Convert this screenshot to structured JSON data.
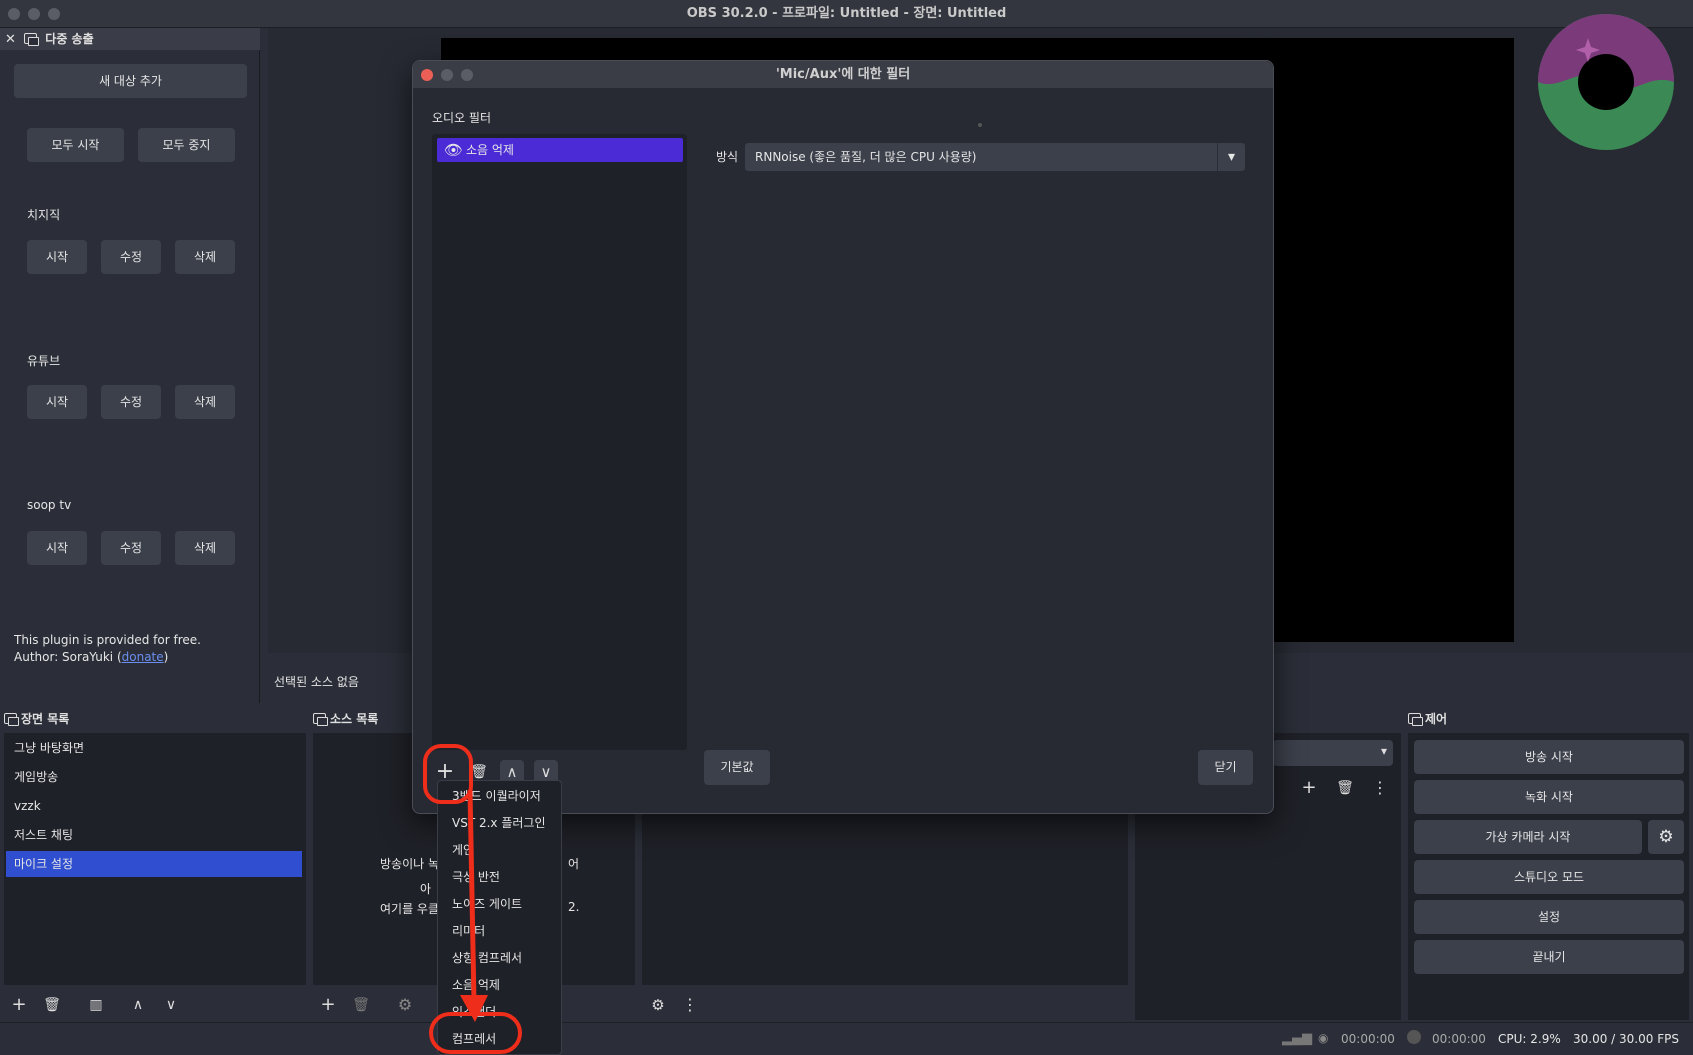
{
  "window": {
    "title": "OBS 30.2.0 - 프로파일: Untitled - 장면: Untitled"
  },
  "multistream": {
    "title": "다중 송출",
    "add_target": "새 대상 추가",
    "start_all": "모두 시작",
    "stop_all": "모두 중지",
    "targets": [
      {
        "name": "치지직",
        "start": "시작",
        "edit": "수정",
        "delete": "삭제"
      },
      {
        "name": "유튜브",
        "start": "시작",
        "edit": "수정",
        "delete": "삭제"
      },
      {
        "name": "soop tv",
        "start": "시작",
        "edit": "수정",
        "delete": "삭제"
      }
    ],
    "footer_line1": "This plugin is provided for free.",
    "footer_prefix": "Author: SoraYuki (",
    "footer_link": "donate",
    "footer_suffix": ")"
  },
  "preview": {
    "no_source": "선택된 소스 없음"
  },
  "scenes": {
    "title": "장면 목록",
    "items": [
      "그냥 바탕화면",
      "게임방송",
      "vzzk",
      "저스트 채팅",
      "마이크 설정"
    ],
    "selected_index": 4
  },
  "sources": {
    "title": "소스 목록",
    "hint_line1": "방송이나 녹",
    "hint_line1_end": "어",
    "hint_line2": "아",
    "hint_line3": "여기를 우클",
    "hint_line3_end": "2."
  },
  "controls": {
    "title": "제어",
    "start_stream": "방송 시작",
    "start_record": "녹화 시작",
    "virtual_cam": "가상 카메라 시작",
    "studio_mode": "스튜디오 모드",
    "settings": "설정",
    "exit": "끝내기"
  },
  "statusbar": {
    "stream_time": "00:00:00",
    "record_time": "00:00:00",
    "cpu": "CPU: 2.9%",
    "fps": "30.00 / 30.00 FPS"
  },
  "filter_dialog": {
    "title": "'Mic/Aux'에 대한 필터",
    "section_label": "오디오 필터",
    "filters": [
      {
        "name": "소음 억제",
        "visible": true
      }
    ],
    "method_label": "방식",
    "method_value": "RNNoise (좋은 품질, 더 많은 CPU 사용량)",
    "defaults_button": "기본값",
    "close_button": "닫기"
  },
  "add_menu": {
    "items": [
      "3밴드 이퀄라이저",
      "VST 2.x 플러그인",
      "게인",
      "극성 반전",
      "노이즈 게이트",
      "리미터",
      "상향 컴프레서",
      "소음 억제",
      "익스팬더",
      "컴프레서"
    ]
  },
  "colors": {
    "accent_purple": "#4b2bd6",
    "selected_blue": "#2f4fd0",
    "annotation_red": "#ee2d1a"
  }
}
